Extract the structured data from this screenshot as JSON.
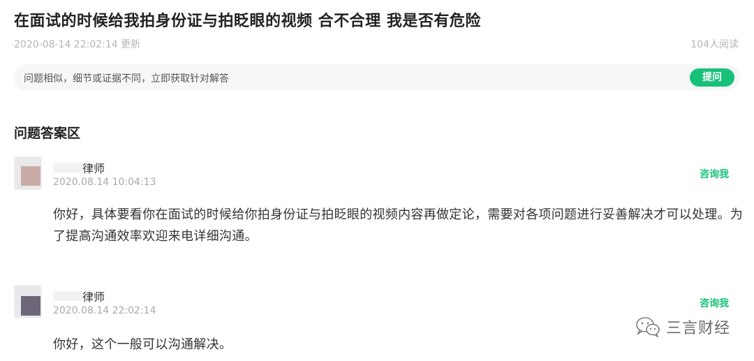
{
  "question": {
    "title": "在面试的时候给我拍身份证与拍眨眼的视频 合不合理 我是否有危险",
    "updated": "2020-08-14 22:02:14 更新",
    "reads": "104人阅读"
  },
  "ask_bar": {
    "prompt": "问题相似，细节或证据不同，立即获取针对解答",
    "button_label": "提问"
  },
  "section_title": "问题答案区",
  "answers": [
    {
      "author": "律师",
      "time": "2020.08.14 10:04:13",
      "consult_label": "咨询我",
      "content": "你好，具体要看你在面试的时候给你拍身份证与拍眨眼的视频内容再做定论，需要对各项问题进行妥善解决才可以处理。为了提高沟通效率欢迎来电详细沟通。",
      "avatar_color": "#c9aca6"
    },
    {
      "author": "律师",
      "time": "2020.08.14 22:02:14",
      "consult_label": "咨询我",
      "content": "你好，这个一般可以沟通解决。",
      "avatar_color": "#6e6678"
    }
  ],
  "watermark": {
    "icon": "wechat-icon",
    "text": "三言财经"
  },
  "colors": {
    "accent": "#17c179",
    "muted": "#b5b5b5"
  }
}
